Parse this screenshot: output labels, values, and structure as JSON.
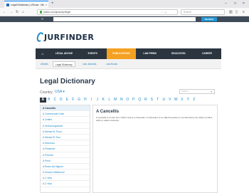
{
  "browser": {
    "tab_title": "Legal Dictionary | USLaw - Mozilla Firefox",
    "tab_close": "×",
    "newtab": "+",
    "url": "justia.com/glossary/legal",
    "search_placeholder": "Search",
    "window_controls": [
      "–",
      "□",
      "×"
    ]
  },
  "site": {
    "search_button": "SEARCH",
    "logo_text": "JURFINDER",
    "nav": [
      {
        "label": "LEGAL ADVICE"
      },
      {
        "label": "EVENTS"
      },
      {
        "label": "PUBLICATIONS"
      },
      {
        "label": "LAW FIRMS"
      },
      {
        "label": "EDUCATION"
      },
      {
        "label": "CAREER"
      }
    ],
    "subnav": [
      {
        "label": "Articles"
      },
      {
        "label": "Legal Dictionary"
      },
      {
        "label": "Law Journals"
      },
      {
        "label": "Law Books"
      }
    ]
  },
  "dictionary": {
    "title": "Legal Dictionary",
    "country_label": "Country:",
    "country_value": "USA ▾",
    "search_placeholder": "Search",
    "letters": [
      "A",
      "B",
      "C",
      "D",
      "E",
      "F",
      "G",
      "H",
      "I",
      "J",
      "K",
      "L",
      "M",
      "N",
      "O",
      "P",
      "Q",
      "R",
      "S",
      "T",
      "U",
      "V",
      "W",
      "X",
      "Y",
      "Z"
    ],
    "terms": [
      "A Cancellis",
      "A Commercial Code",
      "A Letters",
      "A Verbal Argument",
      "A Mensa Et Thoro",
      "A Mensa Et Toro",
      "A Nouveau",
      "A Posteriori",
      "A Prendre",
      "A Priori",
      "A Rubro Ad Nigrum",
      "A Vinculo Matrimonii",
      "A-1 Visa",
      "A-2 Visa"
    ],
    "definition_title": "A Cancellis",
    "definition_text": "A cancellis is a Latin term which means a chancellor. A chancellor is so called because of a performance the duties of office within a railed enclosure."
  }
}
